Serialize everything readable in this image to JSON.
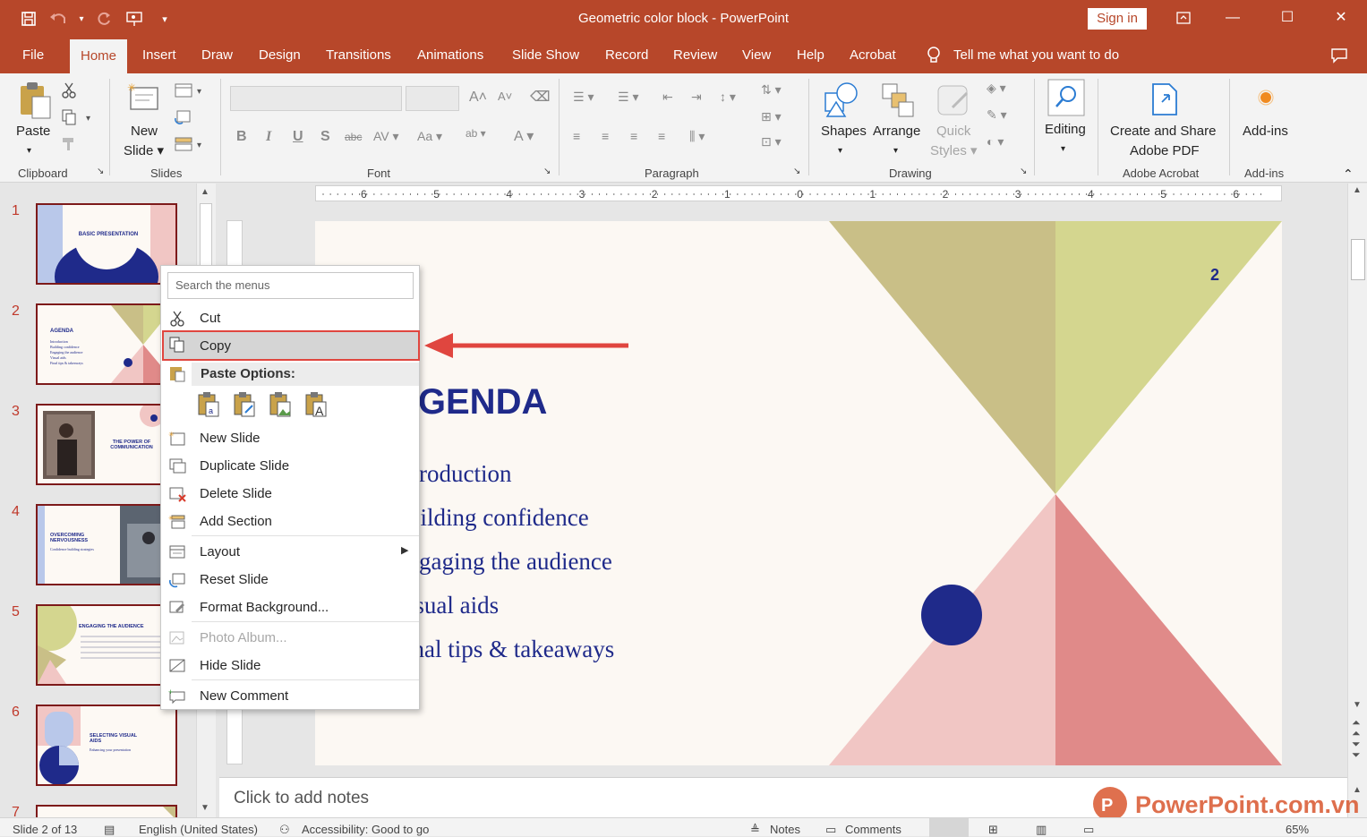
{
  "window": {
    "title": "Geometric color block - PowerPoint",
    "sign_in": "Sign in"
  },
  "tabs": [
    "File",
    "Home",
    "Insert",
    "Draw",
    "Design",
    "Transitions",
    "Animations",
    "Slide Show",
    "Record",
    "Review",
    "View",
    "Help",
    "Acrobat"
  ],
  "active_tab": "Home",
  "tell_me": "Tell me what you want to do",
  "ribbon": {
    "paste": "Paste",
    "new_slide_1": "New",
    "new_slide_2": "Slide",
    "shapes": "Shapes",
    "arrange": "Arrange",
    "quick_styles_1": "Quick",
    "quick_styles_2": "Styles",
    "editing": "Editing",
    "create_share_1": "Create and Share",
    "create_share_2": "Adobe PDF",
    "addins": "Add-ins",
    "groups": {
      "clipboard": "Clipboard",
      "slides": "Slides",
      "font": "Font",
      "paragraph": "Paragraph",
      "drawing": "Drawing",
      "adobe": "Adobe Acrobat",
      "addins": "Add-ins"
    }
  },
  "ruler_marks": [
    "6",
    "5",
    "4",
    "3",
    "2",
    "1",
    "0",
    "1",
    "2",
    "3",
    "4",
    "5",
    "6"
  ],
  "thumbnails": [
    {
      "num": "1",
      "title": "BASIC PRESENTATION"
    },
    {
      "num": "2",
      "title": "AGENDA",
      "items": [
        "Introduction",
        "Building confidence",
        "Engaging the audience",
        "Visual aids",
        "Final tips & takeaways"
      ]
    },
    {
      "num": "3",
      "title": "THE POWER OF COMMUNICATION"
    },
    {
      "num": "4",
      "title": "OVERCOMING NERVOUSNESS",
      "sub": "Confidence building strategies"
    },
    {
      "num": "5",
      "title": "ENGAGING THE AUDIENCE"
    },
    {
      "num": "6",
      "title": "SELECTING VISUAL AIDS",
      "sub": "Enhancing your presentation"
    },
    {
      "num": "7"
    }
  ],
  "slide": {
    "page_number": "2",
    "title": "AGENDA",
    "items": [
      "Introduction",
      "Building confidence",
      "Engaging the audience",
      "Visual aids",
      "Final tips & takeaways"
    ],
    "colors": {
      "olive": "#c9bf87",
      "lime": "#d4d68f",
      "pink": "#f1c6c4",
      "rose": "#e08a89",
      "navy": "#1f2a8a",
      "bg": "#fcf8f3"
    }
  },
  "notes_placeholder": "Click to add notes",
  "context_menu": {
    "search_placeholder": "Search the menus",
    "cut": "Cut",
    "copy": "Copy",
    "paste_options": "Paste Options:",
    "new_slide": "New Slide",
    "duplicate_slide": "Duplicate Slide",
    "delete_slide": "Delete Slide",
    "add_section": "Add Section",
    "layout": "Layout",
    "reset_slide": "Reset Slide",
    "format_background": "Format Background...",
    "photo_album": "Photo Album...",
    "hide_slide": "Hide Slide",
    "new_comment": "New Comment"
  },
  "status": {
    "slide_of": "Slide 2 of 13",
    "language": "English (United States)",
    "accessibility": "Accessibility: Good to go",
    "notes": "Notes",
    "comments": "Comments",
    "zoom": "65%"
  },
  "watermark": "PowerPoint.com.vn",
  "accent": "#b7472a",
  "highlight": "#e0463f"
}
